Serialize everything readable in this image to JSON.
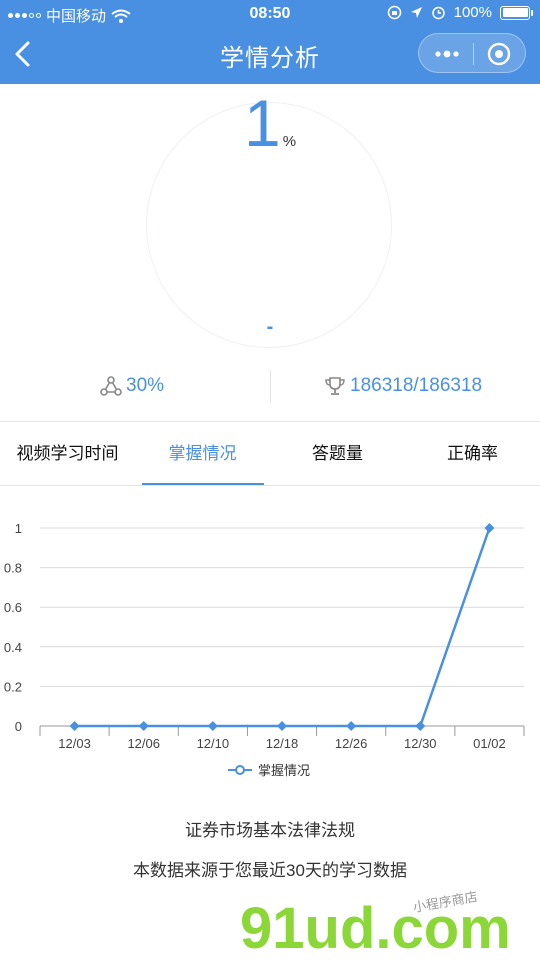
{
  "status_bar": {
    "carrier": "中国移动",
    "time": "08:50",
    "battery": "100%"
  },
  "header": {
    "title": "学情分析"
  },
  "score": {
    "value": "1",
    "unit": "%",
    "dash": "-"
  },
  "stats": {
    "ratio": "30%",
    "rank": "186318/186318"
  },
  "tabs": [
    {
      "label": "视频学习时间"
    },
    {
      "label": "掌握情况"
    },
    {
      "label": "答题量"
    },
    {
      "label": "正确率"
    }
  ],
  "chart_data": {
    "type": "line",
    "categories": [
      "12/03",
      "12/06",
      "12/10",
      "12/18",
      "12/26",
      "12/30",
      "01/02"
    ],
    "series": [
      {
        "name": "掌握情况",
        "values": [
          0,
          0,
          0,
          0,
          0,
          0,
          1
        ]
      }
    ],
    "ylim": [
      0,
      1
    ],
    "yticks": [
      "0",
      "0.2",
      "0.4",
      "0.6",
      "0.8",
      "1"
    ],
    "grid": true,
    "legend": "bottom-center",
    "color": "#4a90e2"
  },
  "footer": {
    "line1": "证券市场基本法律法规",
    "line2": "本数据来源于您最近30天的学习数据"
  },
  "watermark": {
    "text": "91ud.com",
    "subtext": "小程序商店"
  }
}
